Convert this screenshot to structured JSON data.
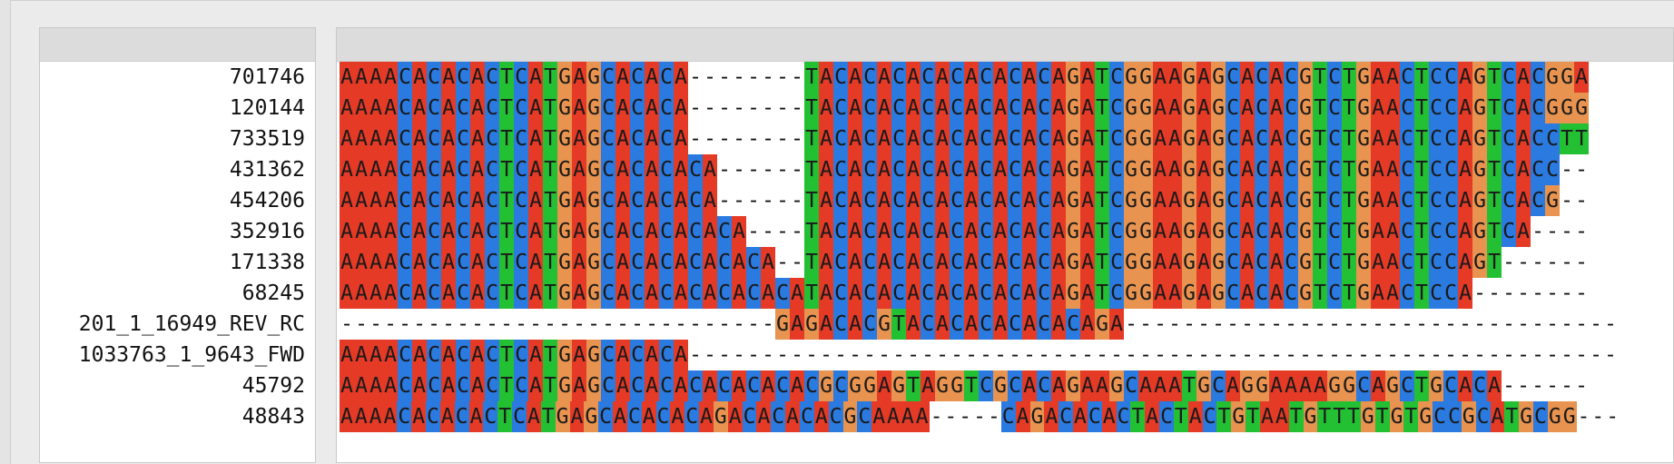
{
  "colors": {
    "A": "#e43a26",
    "C": "#2a7ae0",
    "G": "#e8934f",
    "T": "#23c033"
  },
  "sequences": [
    {
      "name": "701746",
      "seq": "AAAACACACACTCATGAGCACACA--------TACACACACACACACACAGATCGGAAGAGCACACGTCTGAACTCCAGTCACGGA"
    },
    {
      "name": "120144",
      "seq": "AAAACACACACTCATGAGCACACA--------TACACACACACACACACAGATCGGAAGAGCACACGTCTGAACTCCAGTCACGGG"
    },
    {
      "name": "733519",
      "seq": "AAAACACACACTCATGAGCACACA--------TACACACACACACACACAGATCGGAAGAGCACACGTCTGAACTCCAGTCACCTT"
    },
    {
      "name": "431362",
      "seq": "AAAACACACACTCATGAGCACACACA------TACACACACACACACACAGATCGGAAGAGCACACGTCTGAACTCCAGTCACC--"
    },
    {
      "name": "454206",
      "seq": "AAAACACACACTCATGAGCACACACA------TACACACACACACACACAGATCGGAAGAGCACACGTCTGAACTCCAGTCACG--"
    },
    {
      "name": "352916",
      "seq": "AAAACACACACTCATGAGCACACACACA----TACACACACACACACACAGATCGGAAGAGCACACGTCTGAACTCCAGTCA----"
    },
    {
      "name": "171338",
      "seq": "AAAACACACACTCATGAGCACACACACACA--TACACACACACACACACAGATCGGAAGAGCACACGTCTGAACTCCAGT------"
    },
    {
      "name": "68245",
      "seq": "AAAACACACACTCATGAGCACACACACACACATACACACACACACACACAGATCGGAAGAGCACACGTCTGAACTCCA--------"
    },
    {
      "name": "201_1_16949_REV_RC",
      "seq": "------------------------------GAGACACGTACACACACACACAGA----------------------------------"
    },
    {
      "name": "1033763_1_9643_FWD",
      "seq": "AAAACACACACTCATGAGCACACA----------------------------------------------------------------"
    },
    {
      "name": "45792",
      "seq": "AAAACACACACTCATGAGCACACACACACACACGCGGAGTAGGTCGCACAGAAGCAAATGCAGGAAAAGGCAGCTGCACA------"
    },
    {
      "name": "48843",
      "seq": "AAAACACACACTCATGAGCACACACAGACACACACGCAAAA-----CAGACACACTACTACTGTAATGTTTGTGTGCCGCATGCGG---"
    }
  ]
}
